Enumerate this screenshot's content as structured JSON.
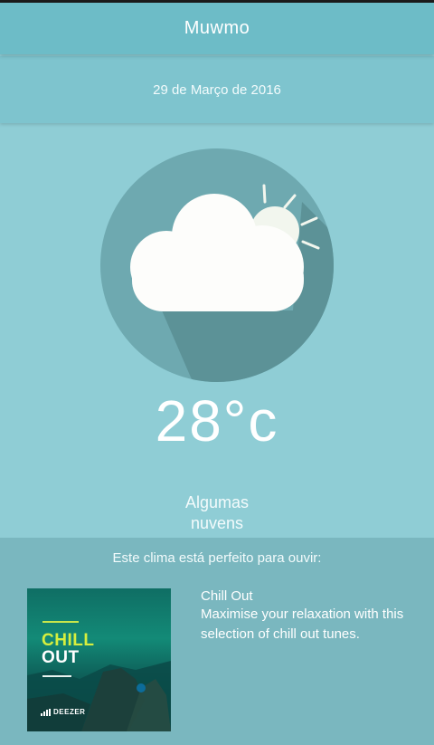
{
  "app": {
    "title": "Muwmo"
  },
  "weather": {
    "date": "29 de Março de 2016",
    "temperature": "28°c",
    "condition_line1": "Algumas",
    "condition_line2": "nuvens",
    "icon": "partly-cloudy-icon"
  },
  "music": {
    "heading": "Este clima está perfeito para ouvir:",
    "playlist_title": "Chill Out",
    "playlist_description": "Maximise your relaxation with this selection of chill out tunes.",
    "cover": {
      "title_line1": "CHILL",
      "title_line2": "OUT",
      "brand": "DEEZER"
    }
  },
  "colors": {
    "header": "#6dbcc7",
    "date_bar": "#7ec4ce",
    "background": "#8fcdd5",
    "icon_circle": "#6ea9b0",
    "music_panel": "#7ab7bf",
    "cover_accent": "#d6ef3e"
  }
}
